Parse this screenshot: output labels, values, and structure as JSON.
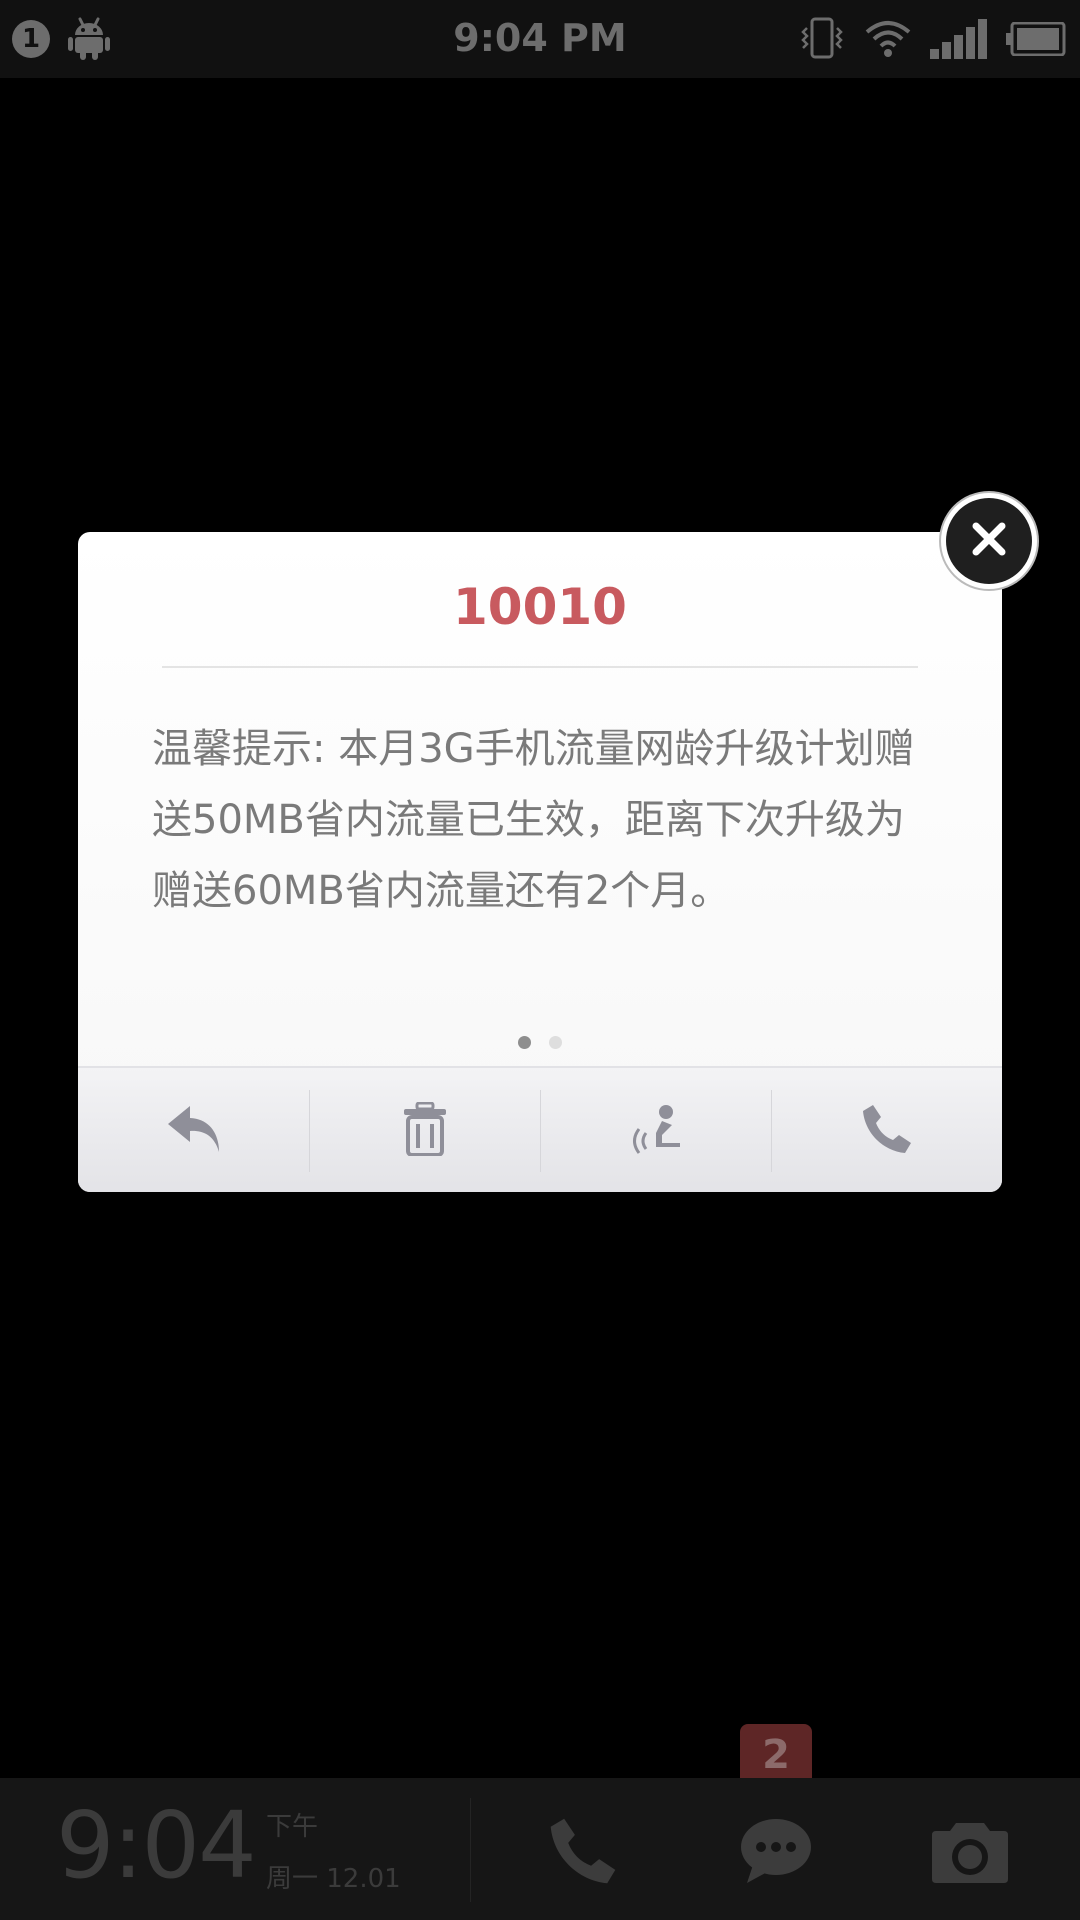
{
  "status_bar": {
    "notification_count": "1",
    "time": "9:04 PM",
    "icons": [
      "android-icon",
      "vibrate-icon",
      "wifi-icon",
      "signal-icon",
      "battery-icon"
    ]
  },
  "popup": {
    "sender": "10010",
    "message": "温馨提示: 本月3G手机流量网龄升级计划赠送50MB省内流量已生效，距离下次升级为赠送60MB省内流量还有2个月。",
    "page_index": 1,
    "page_count": 2,
    "actions": [
      "reply-icon",
      "trash-icon",
      "voice-readout-icon",
      "phone-icon"
    ],
    "colors": {
      "title": "#c85a5f",
      "body_text": "#7a7a7a",
      "icon": "#8f8f99"
    }
  },
  "dock": {
    "time": "9:04",
    "ampm": "下午",
    "date": "周一   12.01",
    "message_badge": "2",
    "buttons": [
      "phone-icon",
      "messages-icon",
      "camera-icon"
    ]
  }
}
